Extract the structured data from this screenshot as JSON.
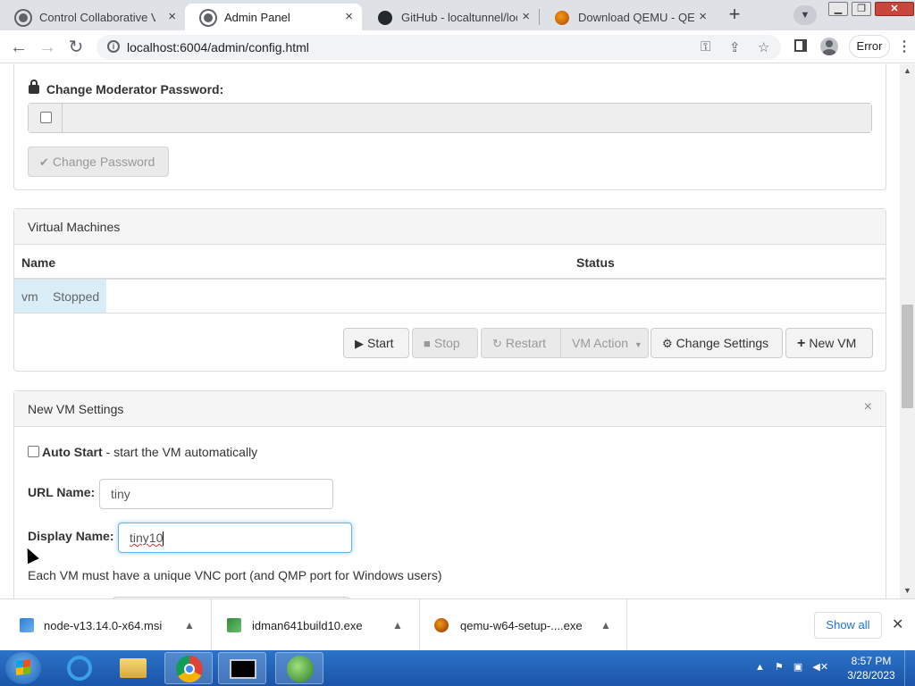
{
  "browser": {
    "tabs": [
      {
        "label": "Control Collaborative Virtual Machines",
        "active": false
      },
      {
        "label": "Admin Panel",
        "active": true
      },
      {
        "label": "GitHub - localtunnel/localtunnel",
        "active": false
      },
      {
        "label": "Download QEMU - QEMU",
        "active": false
      }
    ],
    "tab_close_glyph": "×",
    "new_tab_glyph": "+",
    "url": "localhost:6004/admin/config.html",
    "profile_status": "Error",
    "window_controls": {
      "minimize": "▁",
      "restore": "❐",
      "close": "✕"
    }
  },
  "moderator": {
    "title": "Change Moderator Password:",
    "password_value": "",
    "button_label": "Change Password"
  },
  "vms": {
    "heading": "Virtual Machines",
    "columns": [
      "Name",
      "Status"
    ],
    "rows": [
      {
        "name": "vm",
        "status": "Stopped"
      }
    ],
    "actions": {
      "start": "Start",
      "stop": "Stop",
      "restart": "Restart",
      "vm_action": "VM Action",
      "change_settings": "Change Settings",
      "new_vm": "New VM"
    }
  },
  "new_vm": {
    "heading": "New VM Settings",
    "close_glyph": "×",
    "auto_start_bold": "Auto Start",
    "auto_start_desc": "- start the VM automatically",
    "auto_start_checked": false,
    "url_name_label": "URL Name:",
    "url_name_value": "tiny",
    "display_name_label": "Display Name:",
    "display_name_value": "tiny10",
    "vnc_note": "Each VM must have a unique VNC port (and QMP port for Windows users)"
  },
  "downloads": {
    "items": [
      {
        "filename": "node-v13.14.0-x64.msi"
      },
      {
        "filename": "idman641build10.exe"
      },
      {
        "filename": "qemu-w64-setup-....exe"
      }
    ],
    "show_all": "Show all",
    "close_glyph": "✕"
  },
  "taskbar": {
    "time": "8:57 PM",
    "date": "3/28/2023"
  },
  "colors": {
    "chrome_tabstrip": "#dee1e6",
    "panel_heading": "#f5f5f5",
    "vm_row_highlight": "#d9edf7",
    "focus_border": "#66afe9",
    "taskbar": "#1a55a8"
  }
}
